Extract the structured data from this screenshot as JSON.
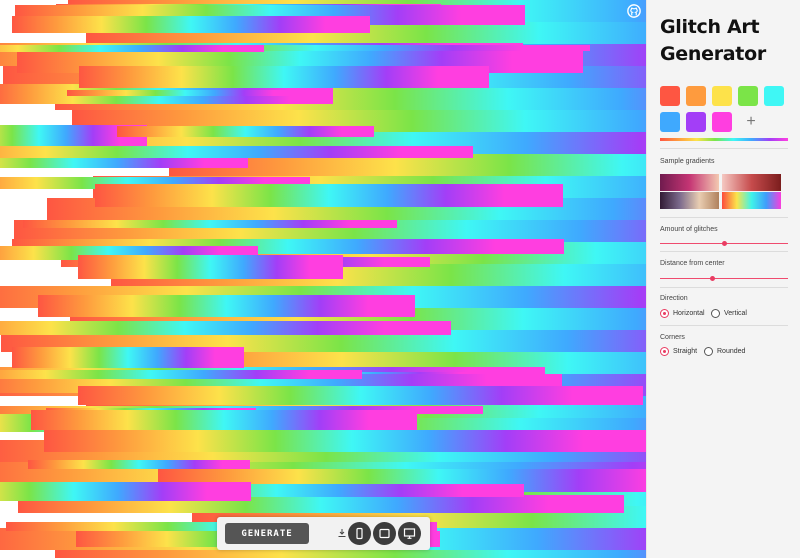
{
  "app": {
    "title": "Glitch Art Generator"
  },
  "colors": {
    "palette": [
      "#fe5642",
      "#fe9b3e",
      "#fde24a",
      "#7be448",
      "#3ff7f5",
      "#3fa9fe",
      "#a33ef7",
      "#ff3ee0"
    ],
    "accent": "#e93c62"
  },
  "sidebar": {
    "add_color_label": "+",
    "sample_gradients_label": "Sample gradients",
    "amount_label": "Amount of glitches",
    "amount_value": 0.5,
    "distance_label": "Distance from center",
    "distance_value": 0.4,
    "direction_label": "Direction",
    "direction_options": [
      {
        "label": "Horizontal",
        "checked": true
      },
      {
        "label": "Vertical",
        "checked": false
      }
    ],
    "corners_label": "Corners",
    "corner_options": [
      {
        "label": "Straight",
        "checked": true
      },
      {
        "label": "Rounded",
        "checked": false
      }
    ]
  },
  "toolbar": {
    "generate_label": "GENERATE",
    "download_icon": "download-icon",
    "device_icons": [
      "phone-icon",
      "tablet-icon",
      "desktop-icon"
    ]
  },
  "icons": {
    "github": "github-icon"
  }
}
